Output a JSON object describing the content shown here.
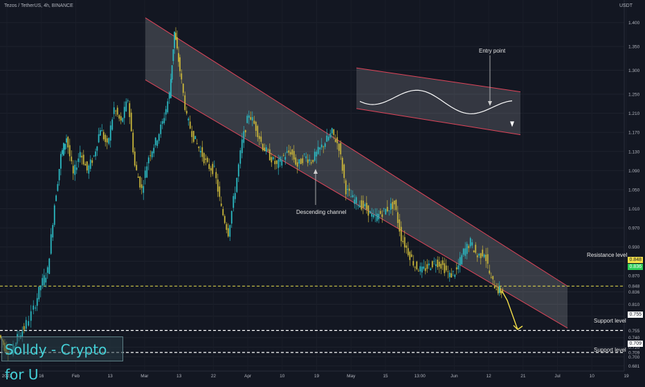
{
  "header": {
    "symbol_line": "Tezos / TetherUS, 4h, BINANCE",
    "currency": "USDT"
  },
  "branding": {
    "watermark": "Solldy - Crypto for U"
  },
  "annotations": {
    "entry_point": "Entry point",
    "descending_channel": "Descending channel",
    "resistance": "Resistance level",
    "support_1": "Support level",
    "support_2": "Support level"
  },
  "price_tags": {
    "resistance": "0.848",
    "current": "0.836",
    "support_1": "0.755",
    "support_2": "0.709"
  },
  "colors": {
    "background": "#131722",
    "candle_up": "#2bb8c1",
    "candle_down": "#c8b53a",
    "channel_fill": "rgba(255,255,255,0.16)",
    "channel_border": "#e0455a",
    "resistance_line": "#e8e04a",
    "support_line": "#ffffff",
    "forecast_arrow": "#f5e04a",
    "current_tag": "#2fce58",
    "resistance_tag": "#f5e04a"
  },
  "chart_data": {
    "type": "candlestick",
    "pair": "XTZ/USDT",
    "interval": "4h",
    "exchange": "BINANCE",
    "y_axis_ticks": [
      "1.400",
      "1.350",
      "1.300",
      "1.250",
      "1.210",
      "1.170",
      "1.130",
      "1.090",
      "1.050",
      "1.010",
      "0.970",
      "0.930",
      "0.900",
      "0.870",
      "0.848",
      "0.836",
      "0.810",
      "0.785",
      "0.755",
      "0.740",
      "0.720",
      "0.709",
      "0.700",
      "0.681"
    ],
    "x_axis_ticks": [
      "2023",
      "16",
      "Feb",
      "13",
      "Mar",
      "13",
      "22",
      "Apr",
      "10",
      "19",
      "May",
      "15",
      "13:00",
      "Jun",
      "12",
      "21",
      "Jul",
      "10",
      "19"
    ],
    "ylim": [
      0.67,
      1.44
    ],
    "levels": {
      "resistance": 0.848,
      "support_1": 0.755,
      "support_2": 0.709,
      "current": 0.836
    },
    "price_path": [
      [
        0,
        0.745
      ],
      [
        0.8,
        0.72
      ],
      [
        1.8,
        0.71
      ],
      [
        2.6,
        0.74
      ],
      [
        3.6,
        0.76
      ],
      [
        5,
        0.8
      ],
      [
        6,
        0.85
      ],
      [
        7,
        0.88
      ],
      [
        8,
        1.02
      ],
      [
        8.9,
        1.12
      ],
      [
        9.7,
        1.16
      ],
      [
        10.7,
        1.08
      ],
      [
        11.7,
        1.13
      ],
      [
        12.7,
        1.09
      ],
      [
        13.7,
        1.12
      ],
      [
        14.6,
        1.18
      ],
      [
        15.6,
        1.14
      ],
      [
        16.6,
        1.22
      ],
      [
        17.6,
        1.19
      ],
      [
        18.6,
        1.24
      ],
      [
        19.6,
        1.1
      ],
      [
        20.6,
        1.05
      ],
      [
        21.6,
        1.12
      ],
      [
        22.6,
        1.15
      ],
      [
        23.6,
        1.19
      ],
      [
        24.6,
        1.25
      ],
      [
        25.3,
        1.38
      ],
      [
        26.1,
        1.3
      ],
      [
        27.1,
        1.2
      ],
      [
        28.1,
        1.16
      ],
      [
        29.1,
        1.13
      ],
      [
        30.1,
        1.1
      ],
      [
        31.1,
        1.09
      ],
      [
        32.1,
        1.01
      ],
      [
        33.1,
        0.96
      ],
      [
        34.1,
        1.05
      ],
      [
        35.1,
        1.15
      ],
      [
        36.1,
        1.21
      ],
      [
        37.1,
        1.18
      ],
      [
        38.1,
        1.14
      ],
      [
        39.1,
        1.12
      ],
      [
        40.1,
        1.1
      ],
      [
        41.1,
        1.12
      ],
      [
        42.1,
        1.13
      ],
      [
        43.1,
        1.1
      ],
      [
        44.1,
        1.12
      ],
      [
        45.1,
        1.11
      ],
      [
        46.1,
        1.13
      ],
      [
        47.1,
        1.15
      ],
      [
        48.1,
        1.17
      ],
      [
        49.1,
        1.14
      ],
      [
        50.1,
        1.05
      ],
      [
        51.1,
        1.03
      ],
      [
        52.1,
        1.02
      ],
      [
        53.1,
        1.01
      ],
      [
        54.1,
        0.99
      ],
      [
        55.1,
        1.0
      ],
      [
        56.1,
        1.01
      ],
      [
        57.1,
        1.02
      ],
      [
        58.1,
        0.95
      ],
      [
        59.1,
        0.92
      ],
      [
        60.1,
        0.89
      ],
      [
        61.1,
        0.88
      ],
      [
        62.1,
        0.89
      ],
      [
        63.1,
        0.9
      ],
      [
        64.1,
        0.89
      ],
      [
        65.1,
        0.87
      ],
      [
        66.1,
        0.88
      ],
      [
        67.1,
        0.92
      ],
      [
        68.1,
        0.94
      ],
      [
        69.1,
        0.91
      ],
      [
        70.1,
        0.92
      ],
      [
        71.1,
        0.86
      ],
      [
        72.1,
        0.84
      ],
      [
        72.7,
        0.836
      ]
    ],
    "channel": {
      "upper": [
        [
          21.0,
          1.41
        ],
        [
          82.0,
          0.848
        ]
      ],
      "lower": [
        [
          21.0,
          1.28
        ],
        [
          82.0,
          0.76
        ]
      ]
    },
    "scenario_box": {
      "upper": [
        [
          51.5,
          1.305
        ],
        [
          75.2,
          1.255
        ]
      ],
      "lower": [
        [
          51.5,
          1.22
        ],
        [
          75.2,
          1.165
        ]
      ]
    },
    "forecast": [
      [
        72.6,
        0.836
      ],
      [
        73.3,
        0.818
      ],
      [
        74.8,
        0.757
      ]
    ]
  }
}
